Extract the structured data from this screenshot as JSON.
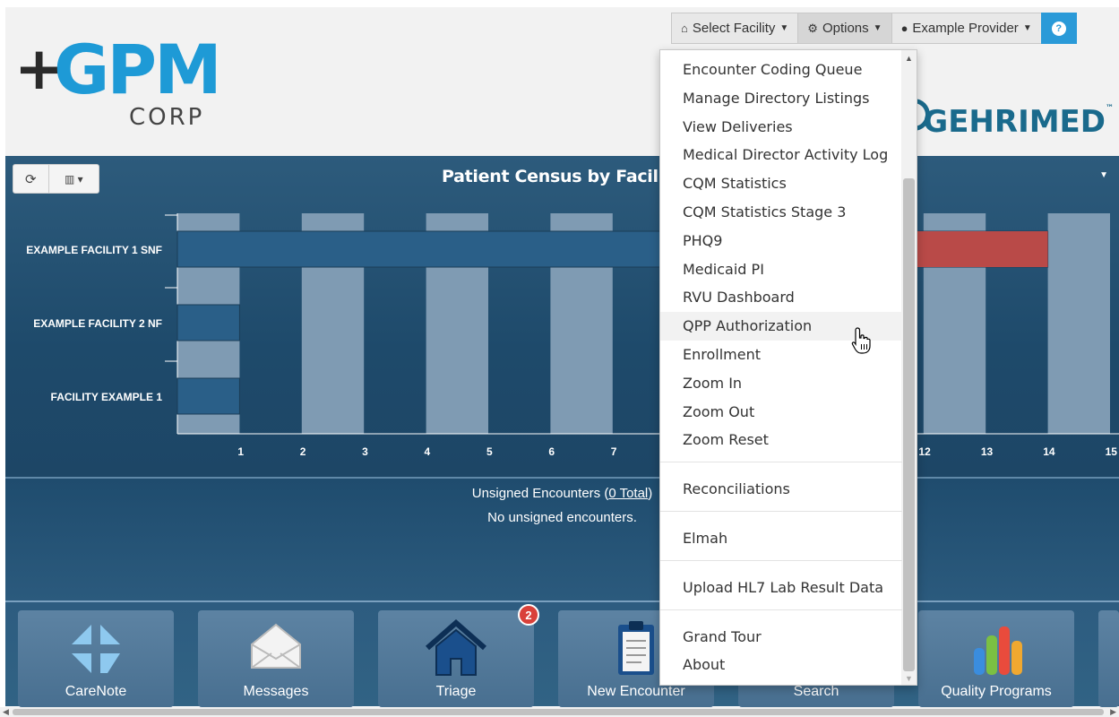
{
  "brand": {
    "logo_plus": "+",
    "logo_main": "GPM",
    "logo_sub": "CORP",
    "partner": "GEHRIMED",
    "partner_tm": "™"
  },
  "topnav": {
    "select_facility": "Select Facility",
    "options": "Options",
    "provider": "Example Provider",
    "help": "?"
  },
  "chart_panel": {
    "title": "Patient Census by Facil"
  },
  "chart_data": {
    "type": "bar",
    "orientation": "horizontal",
    "title": "Patient Census by Facil",
    "categories": [
      "EXAMPLE FACILITY 1 SNF",
      "EXAMPLE FACILITY 2 NF",
      "FACILITY EXAMPLE 1"
    ],
    "values": [
      14,
      1,
      1
    ],
    "x_ticks": [
      "1",
      "2",
      "3",
      "4",
      "5",
      "6",
      "7",
      "12",
      "13",
      "14",
      "15"
    ],
    "xlim": [
      0,
      15
    ],
    "highlight_color": "#b94a48",
    "bar_color": "#2a5f88",
    "grid": true
  },
  "unsigned": {
    "prefix": "Unsigned Encounters (",
    "total_link": "0 Total",
    "suffix": ")",
    "empty": "No unsigned encounters."
  },
  "tiles": [
    {
      "label": "CareNote",
      "icon": "carenote-icon"
    },
    {
      "label": "Messages",
      "icon": "envelope-icon"
    },
    {
      "label": "Triage",
      "icon": "house-icon",
      "badge": "2"
    },
    {
      "label": "New Encounter",
      "icon": "clipboard-icon"
    },
    {
      "label": "Search",
      "icon": "search-icon"
    },
    {
      "label": "Quality Programs",
      "icon": "bar-chart-icon"
    }
  ],
  "options_menu": {
    "items": [
      "Encounter Coding Queue",
      "Manage Directory Listings",
      "View Deliveries",
      "Medical Director Activity Log",
      "CQM Statistics",
      "CQM Statistics Stage 3",
      "PHQ9",
      "Medicaid PI",
      "RVU Dashboard",
      "QPP Authorization",
      "Enrollment",
      "Zoom In",
      "Zoom Out",
      "Zoom Reset",
      "Reconciliations",
      "Elmah",
      "Upload HL7 Lab Result Data",
      "Grand Tour",
      "About"
    ],
    "hovered": "QPP Authorization"
  }
}
